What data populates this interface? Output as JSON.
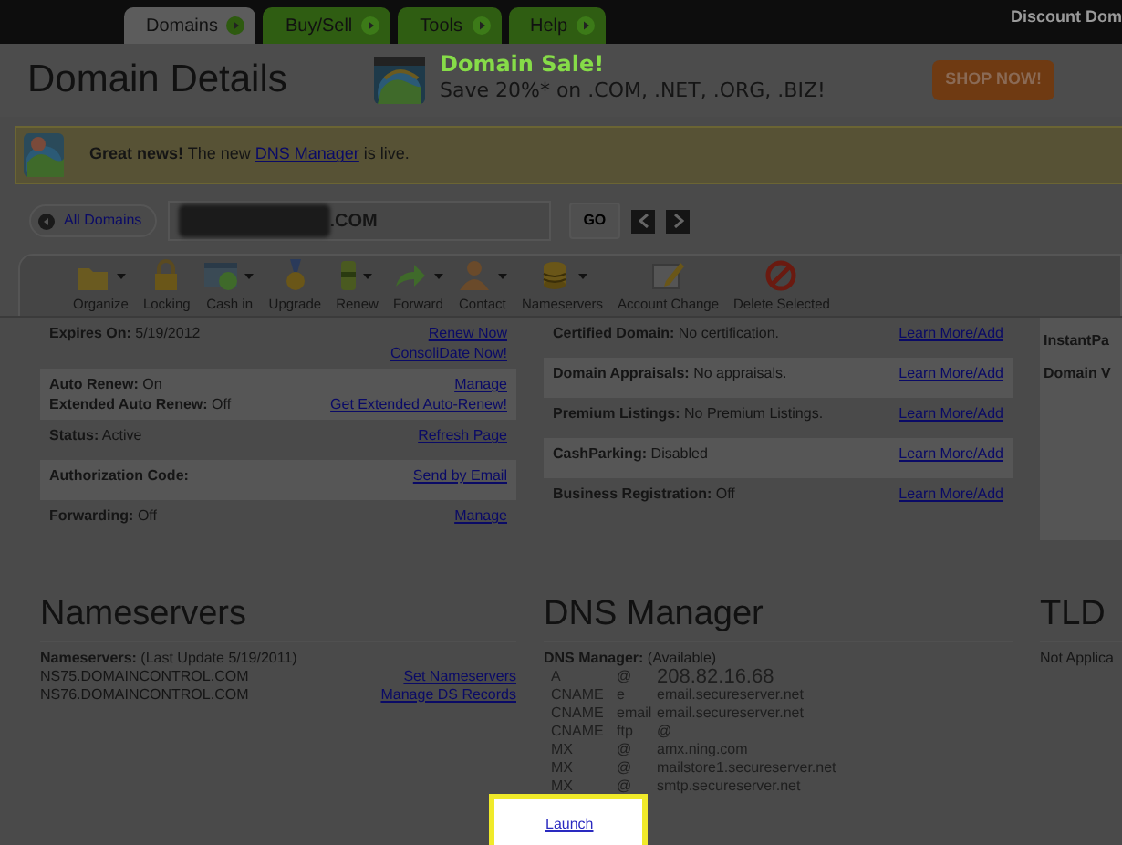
{
  "top_bar": {
    "tabs": [
      {
        "label": "Domains",
        "selected": true
      },
      {
        "label": "Buy/Sell",
        "selected": false
      },
      {
        "label": "Tools",
        "selected": false
      },
      {
        "label": "Help",
        "selected": false
      }
    ],
    "account_text": "Discount Dom"
  },
  "header": {
    "title": "Domain Details",
    "promo_headline": "Domain Sale!",
    "promo_text": "Save 20%* on .COM, .NET, .ORG, .BIZ!",
    "button": "SHOP NOW!"
  },
  "notice": {
    "lead": "Great news!",
    "before": " The new ",
    "link": "DNS Manager",
    "after": " is live."
  },
  "domain_nav": {
    "back": "All Domains",
    "domain": ".COM",
    "go": "GO"
  },
  "toolbar": [
    {
      "label": "Organize",
      "kind": "folder",
      "dropdown": true
    },
    {
      "label": "Locking",
      "kind": "lock",
      "dropdown": false
    },
    {
      "label": "Cash in",
      "kind": "cash",
      "dropdown": true
    },
    {
      "label": "Upgrade",
      "kind": "medal",
      "dropdown": false
    },
    {
      "label": "Renew",
      "kind": "renew",
      "dropdown": true
    },
    {
      "label": "Forward",
      "kind": "forward",
      "dropdown": true
    },
    {
      "label": "Contact",
      "kind": "contact",
      "dropdown": true
    },
    {
      "label": "Nameservers",
      "kind": "database",
      "dropdown": true
    },
    {
      "label": "Account Change",
      "kind": "edit",
      "dropdown": false
    },
    {
      "label": "Delete Selected",
      "kind": "delete",
      "dropdown": false
    }
  ],
  "left_rows": [
    {
      "lines": [
        {
          "label": "Expires On:",
          "value": " 5/19/2012"
        }
      ],
      "links": [
        "Renew Now",
        "ConsoliDate Now!"
      ]
    },
    {
      "lines": [
        {
          "label": "Auto Renew:",
          "value": " On"
        },
        {
          "label": "Extended Auto Renew:",
          "value": " Off"
        }
      ],
      "links": [
        "Manage",
        "Get Extended Auto-Renew!"
      ]
    },
    {
      "lines": [
        {
          "label": "Status:",
          "value": " Active"
        }
      ],
      "links": [
        "Refresh Page"
      ]
    },
    {
      "lines": [
        {
          "label": "Authorization Code:"
        }
      ],
      "links": [
        "Send by Email"
      ]
    },
    {
      "lines": [
        {
          "label": "Forwarding:",
          "value": " Off"
        }
      ],
      "links": [
        "Manage"
      ]
    }
  ],
  "middle_rows": [
    {
      "lines": [
        {
          "label": "Certified Domain:",
          "value": " No certification."
        }
      ],
      "links": [
        "Learn More/Add"
      ]
    },
    {
      "lines": [
        {
          "label": "Domain Appraisals:",
          "value": " No appraisals."
        }
      ],
      "links": [
        "Learn More/Add"
      ]
    },
    {
      "lines": [
        {
          "label": "Premium Listings:",
          "value": " No Premium Listings."
        }
      ],
      "links": [
        "Learn More/Add"
      ]
    },
    {
      "lines": [
        {
          "label": "CashParking:",
          "value": " Disabled"
        }
      ],
      "links": [
        "Learn More/Add"
      ]
    },
    {
      "lines": [
        {
          "label": "Business Registration:",
          "value": " Off"
        }
      ],
      "links": [
        "Learn More/Add"
      ]
    }
  ],
  "right_rows": [
    {
      "lines": [
        {
          "label": "InstantPa"
        }
      ],
      "links": []
    },
    {
      "lines": [
        {
          "label": "Domain V"
        }
      ],
      "links": []
    }
  ],
  "nameservers": {
    "title": "Nameservers",
    "label": "Nameservers:",
    "note": "  (Last Update 5/19/2011)",
    "servers": [
      "NS75.DOMAINCONTROL.COM",
      "NS76.DOMAINCONTROL.COM"
    ],
    "links": [
      "Set Nameservers",
      "Manage DS Records"
    ]
  },
  "dns": {
    "title": "DNS Manager",
    "label": "DNS Manager:",
    "note": " (Available)",
    "records": [
      {
        "type": "A",
        "host": "@",
        "value": "208.82.16.68",
        "large": true
      },
      {
        "type": "CNAME",
        "host": "e",
        "value": "email.secureserver.net",
        "large": false
      },
      {
        "type": "CNAME",
        "host": "email",
        "value": "email.secureserver.net",
        "large": false
      },
      {
        "type": "CNAME",
        "host": "ftp",
        "value": "@",
        "large": false
      },
      {
        "type": "MX",
        "host": "@",
        "value": "amx.ning.com",
        "large": false
      },
      {
        "type": "MX",
        "host": "@",
        "value": "mailstore1.secureserver.net",
        "large": false
      },
      {
        "type": "MX",
        "host": "@",
        "value": "smtp.secureserver.net",
        "large": false
      }
    ],
    "launch": "Launch"
  },
  "tld": {
    "title": "TLD",
    "text": "Not Applica"
  }
}
